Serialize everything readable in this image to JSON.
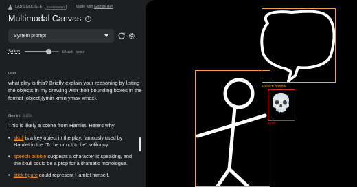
{
  "brand": {
    "name": "LABS.GOOGLE",
    "tag": "EXPERIMENT",
    "made_with": "Made with",
    "api_link": "Gemini API"
  },
  "app": {
    "title": "Multimodal Canvas"
  },
  "prompt_select": {
    "value": "System prompt"
  },
  "safety": {
    "label": "Safety:",
    "value_text": "Block some",
    "level": 0.7
  },
  "user": {
    "role": "User",
    "message": "what play is this? Briefly explain your reasoning by listing the objects in my drawing with their bounding boxes in the format [object](ymin xmin ymax xmax)."
  },
  "gemini": {
    "role": "Gemini",
    "time": "1.63s",
    "intro": "This is likely a scene from Hamlet. Here's why:",
    "bullets": [
      {
        "term": "skull",
        "text": " is a key object in the play, famously used by Hamlet in the \"To be or not to be\" soliloquy."
      },
      {
        "term": "speech bubble",
        "text": " suggests a character is speaking, and the skull could be a prop for a dramatic monologue."
      },
      {
        "term": "stick figure",
        "text": " could represent Hamlet himself."
      }
    ]
  },
  "canvas": {
    "labels": {
      "speech_bubble": "speech bubble",
      "skull": "skull",
      "skull_emoji": "💀"
    },
    "colors": {
      "box": "#e8a44e",
      "skull_box": "#d93025",
      "background": "#000000",
      "stroke": "#ffffff"
    }
  }
}
